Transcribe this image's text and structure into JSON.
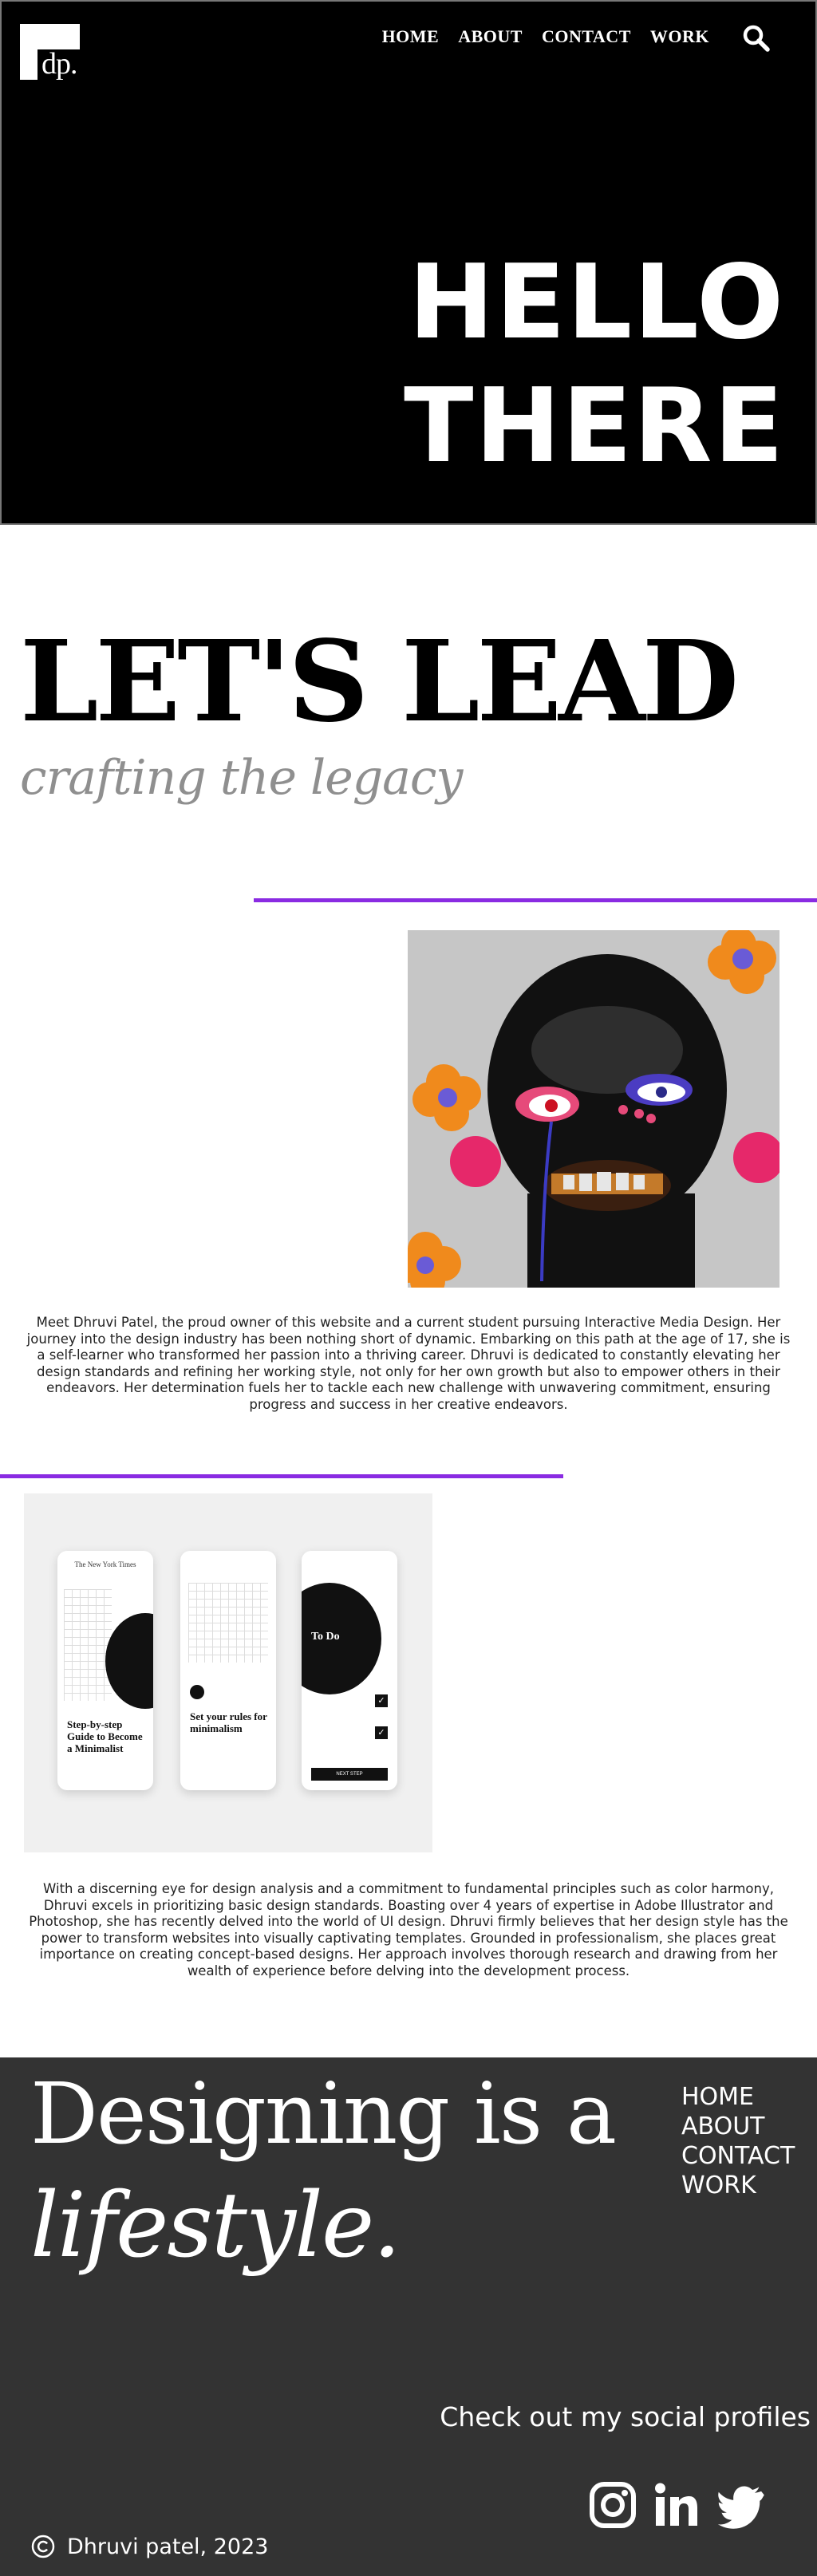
{
  "header": {
    "logo_text": "dp.",
    "nav": [
      "HOME",
      "ABOUT",
      "CONTACT",
      "WORK"
    ],
    "search_icon": "search-icon"
  },
  "hero": {
    "line1": "HELLO",
    "line2": "THERE"
  },
  "lead": {
    "title": "LET'S LEAD",
    "subtitle": "crafting the legacy"
  },
  "accent_color": "#8a2be2",
  "bio_1": "Meet Dhruvi Patel, the proud owner of this website and a current student pursuing Interactive Media Design. Her journey into the design industry has been nothing short of dynamic. Embarking on this path at the age of 17, she is a self-learner who transformed her passion into a thriving career. Dhruvi is dedicated to constantly elevating her design standards and refining her working style, not only for her own growth but also to empower others in their endeavors. Her determination fuels her to tackle each new challenge with unwavering commitment, ensuring progress and success in her creative endeavors.",
  "phones": {
    "p1_brand": "The New York Times",
    "p1_title": "Step-by-step Guide to Become a Minimalist",
    "p2_title": "Set your rules for minimalism",
    "p3_title": "To Do",
    "p3_button": "NEXT STEP"
  },
  "bio_2": "With a discerning eye for design analysis and a commitment to fundamental principles such as color harmony, Dhruvi excels in prioritizing basic design standards. Boasting over 4 years of expertise in Adobe Illustrator and Photoshop, she has recently delved into the world of UI design. Dhruvi firmly believes that her design style has the power to transform websites into visually captivating templates. Grounded in professionalism, she places great importance on creating concept-based designs. Her approach involves thorough research and drawing from her wealth of experience before delving into the development process.",
  "footer": {
    "quote_line1": "Designing is a",
    "quote_line2": "lifestyle.",
    "nav": [
      "HOME",
      "ABOUT",
      "CONTACT",
      "WORK"
    ],
    "social_title": "Check out my social profiles",
    "social_icons": [
      "instagram-icon",
      "linkedin-icon",
      "twitter-icon"
    ],
    "copyright": "Dhruvi patel, 2023"
  }
}
